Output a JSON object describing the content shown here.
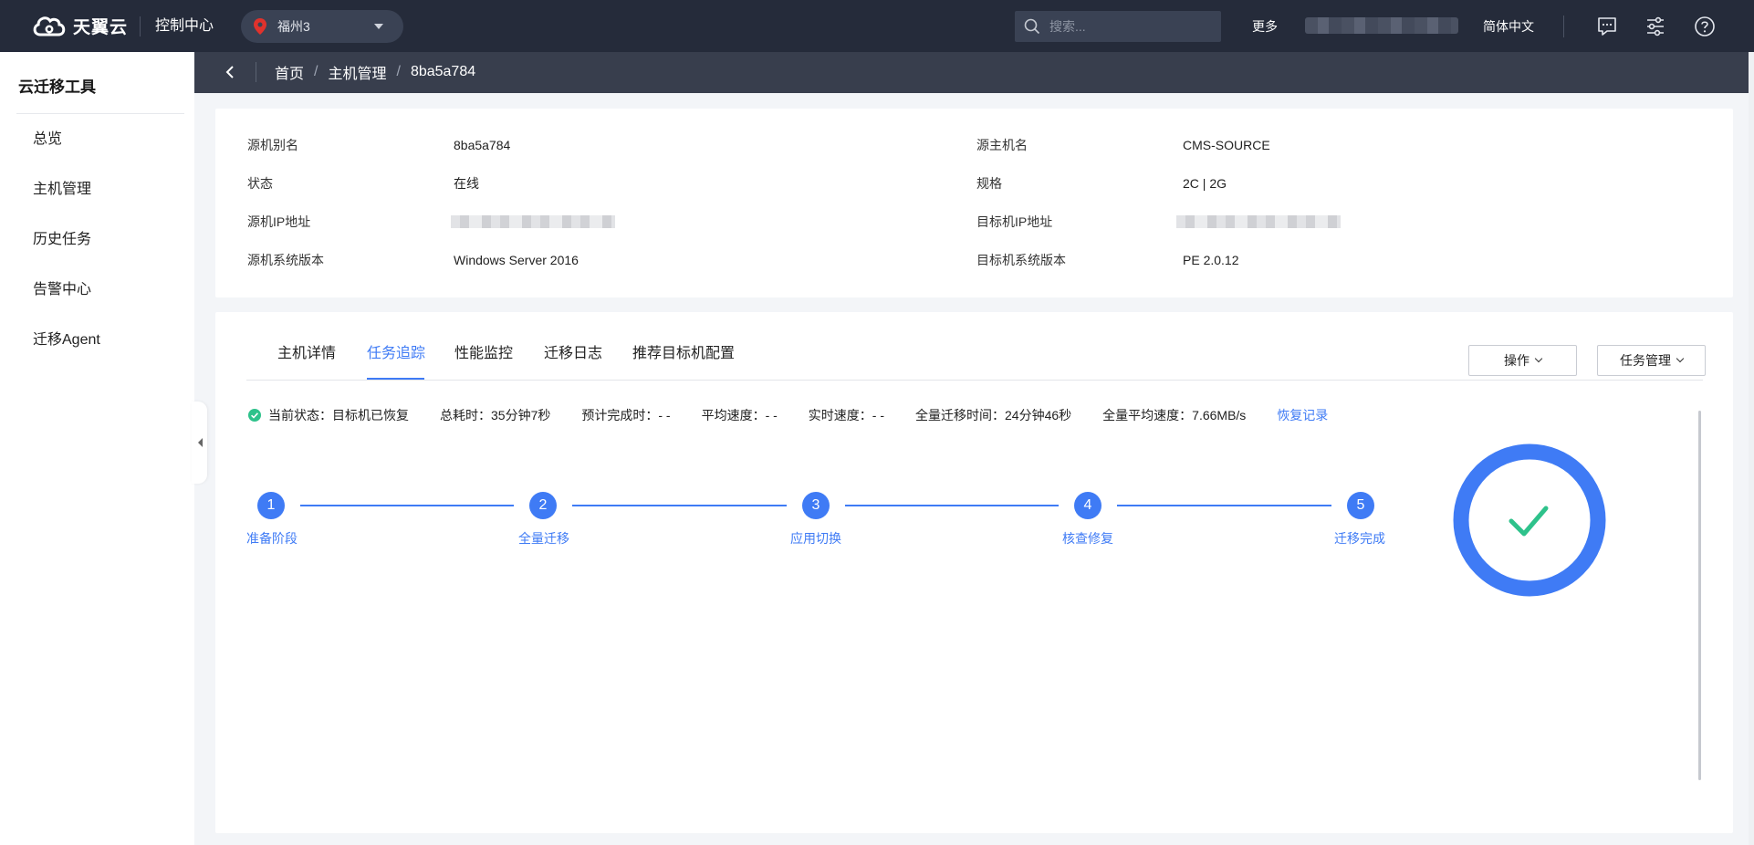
{
  "topbar": {
    "logo_text": "天翼云",
    "console_title": "控制中心",
    "region": "福州3",
    "search_placeholder": "搜索...",
    "more_label": "更多",
    "language": "简体中文",
    "icons": [
      "message-icon",
      "settings-sliders-icon",
      "help-icon"
    ]
  },
  "sidebar": {
    "title": "云迁移工具",
    "items": [
      {
        "label": "总览"
      },
      {
        "label": "主机管理"
      },
      {
        "label": "历史任务"
      },
      {
        "label": "告警中心"
      },
      {
        "label": "迁移Agent"
      }
    ]
  },
  "breadcrumb": {
    "items": [
      "首页",
      "主机管理",
      "8ba5a784"
    ],
    "separator": "/"
  },
  "host_info": {
    "left": [
      {
        "label": "源机别名",
        "value": "8ba5a784"
      },
      {
        "label": "状态",
        "value": "在线"
      },
      {
        "label": "源机IP地址",
        "value": ""
      },
      {
        "label": "源机系统版本",
        "value": "Windows Server 2016"
      }
    ],
    "right": [
      {
        "label": "源主机名",
        "value": "CMS-SOURCE"
      },
      {
        "label": "规格",
        "value": "2C | 2G"
      },
      {
        "label": "目标机IP地址",
        "value": ""
      },
      {
        "label": "目标机系统版本",
        "value": "PE 2.0.12"
      }
    ]
  },
  "tabs": {
    "items": [
      "主机详情",
      "任务追踪",
      "性能监控",
      "迁移日志",
      "推荐目标机配置"
    ],
    "active": "任务追踪"
  },
  "actions": {
    "operate_label": "操作",
    "task_manage_label": "任务管理"
  },
  "task_status": {
    "current_status": "当前状态：目标机已恢复",
    "total_time": "总耗时：35分钟7秒",
    "estimated_finish": "预计完成时：- -",
    "avg_speed": "平均速度：- -",
    "realtime_speed": "实时速度：- -",
    "full_migration_time": "全量迁移时间：24分钟46秒",
    "full_avg_speed": "全量平均速度：7.66MB/s",
    "restore_record_link": "恢复记录"
  },
  "steps": [
    {
      "num": "1",
      "label": "准备阶段"
    },
    {
      "num": "2",
      "label": "全量迁移"
    },
    {
      "num": "3",
      "label": "应用切换"
    },
    {
      "num": "4",
      "label": "核查修复"
    },
    {
      "num": "5",
      "label": "迁移完成"
    }
  ],
  "colors": {
    "accent": "#3f7bf5",
    "success": "#2ec28b",
    "nav_bg": "#252b3a",
    "crumb_bg": "#383e4d"
  }
}
